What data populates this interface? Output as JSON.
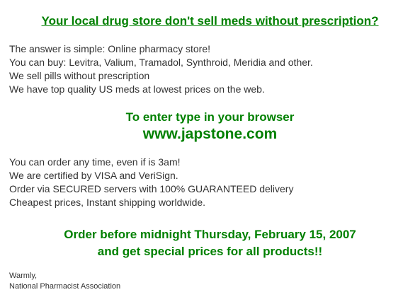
{
  "headline": "Your local drug store don't sell meds without prescription?",
  "intro_lines": [
    "The answer is simple: Online pharmacy store!",
    "You can buy:  Levitra, Valium, Tramadol, Synthroid, Meridia and other.",
    "We sell pills without prescription",
    "We have top quality US meds at lowest prices on the web."
  ],
  "enter_text": "To enter type in your browser",
  "url_text": "www.japstone.com",
  "features_lines": [
    "You can order any time, even if is 3am!",
    "We are certified by VISA and VeriSign.",
    "Order via SECURED servers with 100% GUARANTEED delivery",
    "Cheapest prices, Instant shipping worldwide."
  ],
  "offer_line1": "Order before midnight Thursday, February 15, 2007",
  "offer_line2": "and get special prices for all products!!",
  "signoff": "Warmly,",
  "signature": "National Pharmacist Association",
  "colors": {
    "accent_green": "#008000",
    "body_text": "#333333",
    "background": "#ffffff"
  }
}
